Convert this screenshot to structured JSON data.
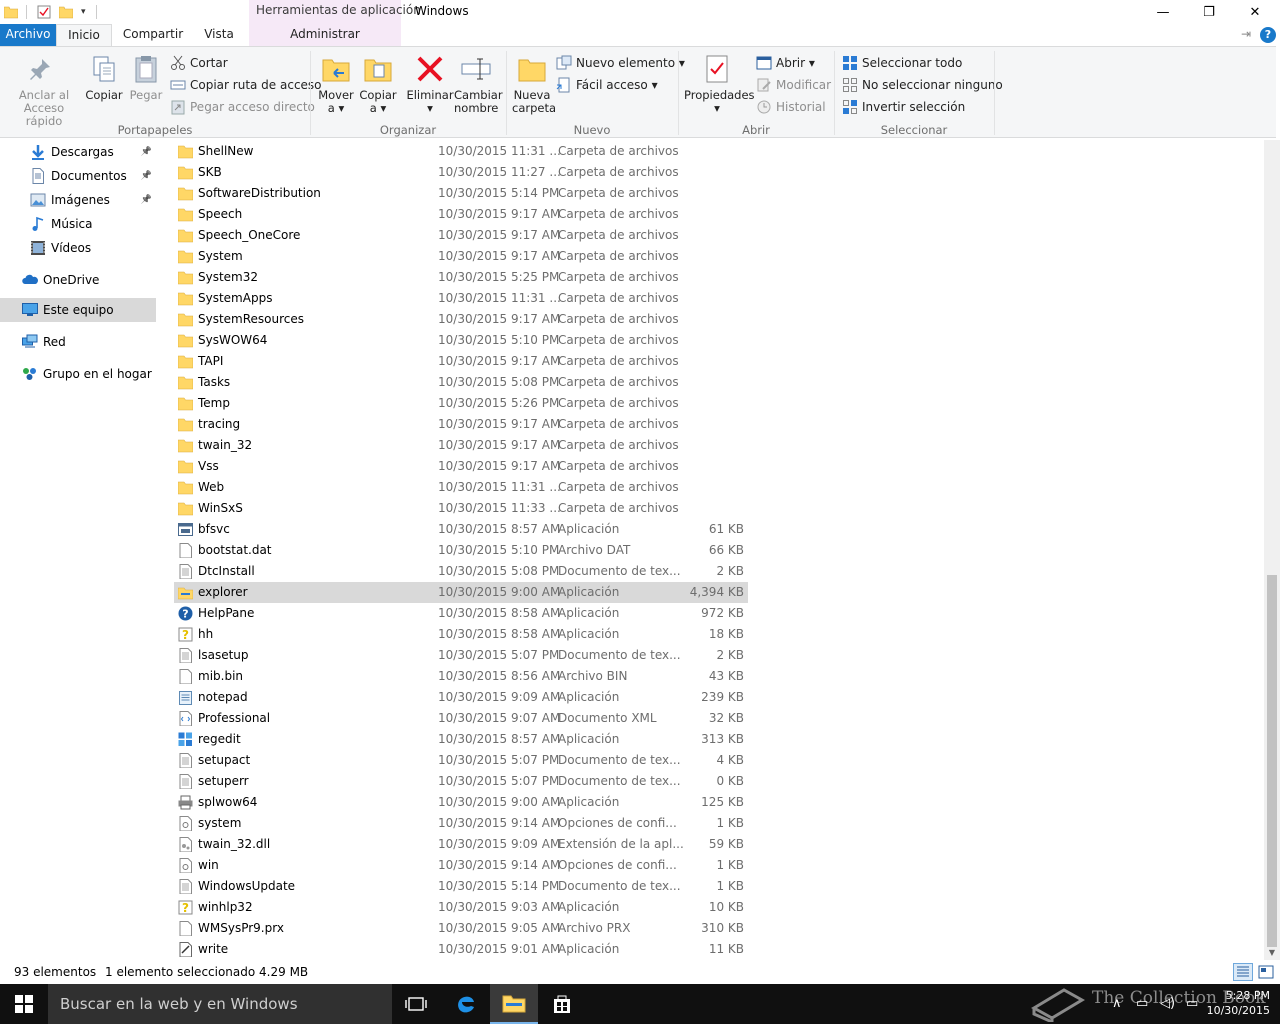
{
  "titlebar": {
    "context_header": "Herramientas de aplicación",
    "title": "Windows",
    "minimize": "—",
    "restore": "❐",
    "close": "✕"
  },
  "tabs": {
    "file": "Archivo",
    "home": "Inicio",
    "share": "Compartir",
    "view": "Vista",
    "manage": "Administrar",
    "help": "?"
  },
  "ribbon": {
    "pin_quick_access": [
      "Anclar al",
      "Acceso rápido"
    ],
    "copy": "Copiar",
    "paste": "Pegar",
    "cut": "Cortar",
    "copy_path": "Copiar ruta de acceso",
    "paste_shortcut": "Pegar acceso directo",
    "clipboard_group": "Portapapeles",
    "move_to": [
      "Mover",
      "a ▾"
    ],
    "copy_to": [
      "Copiar",
      "a ▾"
    ],
    "delete": [
      "Eliminar",
      "▾"
    ],
    "rename": [
      "Cambiar",
      "nombre"
    ],
    "organize_group": "Organizar",
    "new_folder": [
      "Nueva",
      "carpeta"
    ],
    "new_item": "Nuevo elemento ▾",
    "easy_access": "Fácil acceso ▾",
    "new_group": "Nuevo",
    "properties": [
      "Propiedades",
      "▾"
    ],
    "open": "Abrir ▾",
    "edit": "Modificar",
    "history": "Historial",
    "open_group": "Abrir",
    "select_all": "Seleccionar todo",
    "select_none": "No seleccionar ninguno",
    "invert_selection": "Invertir selección",
    "select_group": "Seleccionar"
  },
  "nav": [
    {
      "label": "Descargas",
      "icon": "download-icon",
      "pinned": true
    },
    {
      "label": "Documentos",
      "icon": "documents-icon",
      "pinned": true
    },
    {
      "label": "Imágenes",
      "icon": "pictures-icon",
      "pinned": true
    },
    {
      "label": "Música",
      "icon": "music-icon",
      "pinned": false
    },
    {
      "label": "Vídeos",
      "icon": "videos-icon",
      "pinned": false
    },
    {
      "label": "OneDrive",
      "icon": "onedrive-icon",
      "pinned": false
    },
    {
      "label": "Este equipo",
      "icon": "computer-icon",
      "pinned": false,
      "selected": true
    },
    {
      "label": "Red",
      "icon": "network-icon",
      "pinned": false
    },
    {
      "label": "Grupo en el hogar",
      "icon": "homegroup-icon",
      "pinned": false
    }
  ],
  "files": [
    {
      "name": "ShellNew",
      "date": "10/30/2015 11:31 ...",
      "type": "Carpeta de archivos",
      "size": "",
      "icon": "folder-icon"
    },
    {
      "name": "SKB",
      "date": "10/30/2015 11:27 ...",
      "type": "Carpeta de archivos",
      "size": "",
      "icon": "folder-icon"
    },
    {
      "name": "SoftwareDistribution",
      "date": "10/30/2015 5:14 PM",
      "type": "Carpeta de archivos",
      "size": "",
      "icon": "folder-icon"
    },
    {
      "name": "Speech",
      "date": "10/30/2015 9:17 AM",
      "type": "Carpeta de archivos",
      "size": "",
      "icon": "folder-icon"
    },
    {
      "name": "Speech_OneCore",
      "date": "10/30/2015 9:17 AM",
      "type": "Carpeta de archivos",
      "size": "",
      "icon": "folder-icon"
    },
    {
      "name": "System",
      "date": "10/30/2015 9:17 AM",
      "type": "Carpeta de archivos",
      "size": "",
      "icon": "folder-icon"
    },
    {
      "name": "System32",
      "date": "10/30/2015 5:25 PM",
      "type": "Carpeta de archivos",
      "size": "",
      "icon": "folder-icon"
    },
    {
      "name": "SystemApps",
      "date": "10/30/2015 11:31 ...",
      "type": "Carpeta de archivos",
      "size": "",
      "icon": "folder-icon"
    },
    {
      "name": "SystemResources",
      "date": "10/30/2015 9:17 AM",
      "type": "Carpeta de archivos",
      "size": "",
      "icon": "folder-icon"
    },
    {
      "name": "SysWOW64",
      "date": "10/30/2015 5:10 PM",
      "type": "Carpeta de archivos",
      "size": "",
      "icon": "folder-icon"
    },
    {
      "name": "TAPI",
      "date": "10/30/2015 9:17 AM",
      "type": "Carpeta de archivos",
      "size": "",
      "icon": "folder-icon"
    },
    {
      "name": "Tasks",
      "date": "10/30/2015 5:08 PM",
      "type": "Carpeta de archivos",
      "size": "",
      "icon": "folder-icon"
    },
    {
      "name": "Temp",
      "date": "10/30/2015 5:26 PM",
      "type": "Carpeta de archivos",
      "size": "",
      "icon": "folder-icon"
    },
    {
      "name": "tracing",
      "date": "10/30/2015 9:17 AM",
      "type": "Carpeta de archivos",
      "size": "",
      "icon": "folder-icon"
    },
    {
      "name": "twain_32",
      "date": "10/30/2015 9:17 AM",
      "type": "Carpeta de archivos",
      "size": "",
      "icon": "folder-icon"
    },
    {
      "name": "Vss",
      "date": "10/30/2015 9:17 AM",
      "type": "Carpeta de archivos",
      "size": "",
      "icon": "folder-icon"
    },
    {
      "name": "Web",
      "date": "10/30/2015 11:31 ...",
      "type": "Carpeta de archivos",
      "size": "",
      "icon": "folder-icon"
    },
    {
      "name": "WinSxS",
      "date": "10/30/2015 11:33 ...",
      "type": "Carpeta de archivos",
      "size": "",
      "icon": "folder-icon"
    },
    {
      "name": "bfsvc",
      "date": "10/30/2015 8:57 AM",
      "type": "Aplicación",
      "size": "61 KB",
      "icon": "app-icon"
    },
    {
      "name": "bootstat.dat",
      "date": "10/30/2015 5:10 PM",
      "type": "Archivo DAT",
      "size": "66 KB",
      "icon": "file-icon"
    },
    {
      "name": "DtcInstall",
      "date": "10/30/2015 5:08 PM",
      "type": "Documento de tex...",
      "size": "2 KB",
      "icon": "text-file-icon"
    },
    {
      "name": "explorer",
      "date": "10/30/2015 9:00 AM",
      "type": "Aplicación",
      "size": "4,394 KB",
      "icon": "explorer-icon",
      "selected": true
    },
    {
      "name": "HelpPane",
      "date": "10/30/2015 8:58 AM",
      "type": "Aplicación",
      "size": "972 KB",
      "icon": "help-icon"
    },
    {
      "name": "hh",
      "date": "10/30/2015 8:58 AM",
      "type": "Aplicación",
      "size": "18 KB",
      "icon": "help-file-icon"
    },
    {
      "name": "lsasetup",
      "date": "10/30/2015 5:07 PM",
      "type": "Documento de tex...",
      "size": "2 KB",
      "icon": "text-file-icon"
    },
    {
      "name": "mib.bin",
      "date": "10/30/2015 8:56 AM",
      "type": "Archivo BIN",
      "size": "43 KB",
      "icon": "file-icon"
    },
    {
      "name": "notepad",
      "date": "10/30/2015 9:09 AM",
      "type": "Aplicación",
      "size": "239 KB",
      "icon": "notepad-icon"
    },
    {
      "name": "Professional",
      "date": "10/30/2015 9:07 AM",
      "type": "Documento XML",
      "size": "32 KB",
      "icon": "xml-file-icon"
    },
    {
      "name": "regedit",
      "date": "10/30/2015 8:57 AM",
      "type": "Aplicación",
      "size": "313 KB",
      "icon": "regedit-icon"
    },
    {
      "name": "setupact",
      "date": "10/30/2015 5:07 PM",
      "type": "Documento de tex...",
      "size": "4 KB",
      "icon": "text-file-icon"
    },
    {
      "name": "setuperr",
      "date": "10/30/2015 5:07 PM",
      "type": "Documento de tex...",
      "size": "0 KB",
      "icon": "text-file-icon"
    },
    {
      "name": "splwow64",
      "date": "10/30/2015 9:00 AM",
      "type": "Aplicación",
      "size": "125 KB",
      "icon": "printer-icon"
    },
    {
      "name": "system",
      "date": "10/30/2015 9:14 AM",
      "type": "Opciones de confi...",
      "size": "1 KB",
      "icon": "config-file-icon"
    },
    {
      "name": "twain_32.dll",
      "date": "10/30/2015 9:09 AM",
      "type": "Extensión de la apl...",
      "size": "59 KB",
      "icon": "dll-file-icon"
    },
    {
      "name": "win",
      "date": "10/30/2015 9:14 AM",
      "type": "Opciones de confi...",
      "size": "1 KB",
      "icon": "config-file-icon"
    },
    {
      "name": "WindowsUpdate",
      "date": "10/30/2015 5:14 PM",
      "type": "Documento de tex...",
      "size": "1 KB",
      "icon": "text-file-icon"
    },
    {
      "name": "winhlp32",
      "date": "10/30/2015 9:03 AM",
      "type": "Aplicación",
      "size": "10 KB",
      "icon": "help-file-icon"
    },
    {
      "name": "WMSysPr9.prx",
      "date": "10/30/2015 9:05 AM",
      "type": "Archivo PRX",
      "size": "310 KB",
      "icon": "file-icon"
    },
    {
      "name": "write",
      "date": "10/30/2015 9:01 AM",
      "type": "Aplicación",
      "size": "11 KB",
      "icon": "write-icon"
    }
  ],
  "status": {
    "count": "93 elementos",
    "selection": "1 elemento seleccionado  4.29 MB"
  },
  "taskbar": {
    "search_placeholder": "Buscar en la web y en Windows",
    "time": "5:28 PM",
    "date": "10/30/2015",
    "watermark": "The Collection Book"
  },
  "colors": {
    "accent": "#1979ca",
    "folder": "#ffd766",
    "selection": "#d9d9d9",
    "context_tab": "#f6e9f7",
    "delete_red": "#e81123"
  }
}
